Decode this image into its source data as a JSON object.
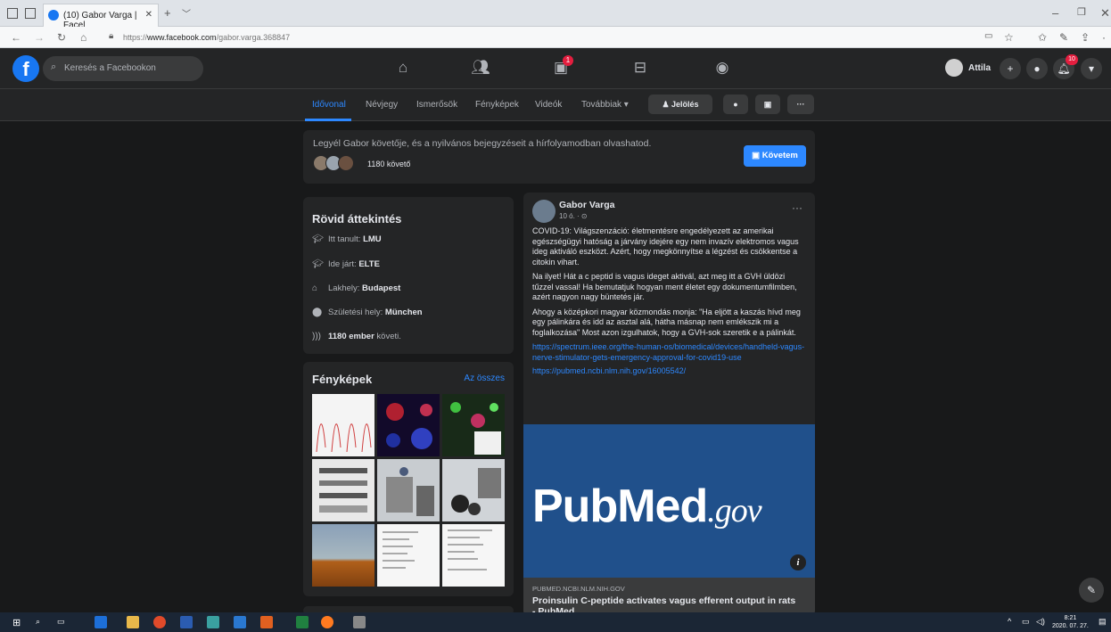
{
  "browser": {
    "tab_title": "(10) Gabor Varga | Facel",
    "url_prefix": "https://",
    "url_host": "www.facebook.com",
    "url_path": "/gabor.varga.368847"
  },
  "fbnav": {
    "search_placeholder": "Keresés a Facebookon",
    "watch_badge": "1",
    "user_name": "Attila",
    "notif_badge": "10"
  },
  "profile_tabs": {
    "items": [
      "Idővonal",
      "Névjegy",
      "Ismerősök",
      "Fényképek",
      "Videók",
      "Továbbiak ▾"
    ],
    "tag_button": "Jelölés",
    "more_button": "···"
  },
  "follow_box": {
    "text": "Legyél Gabor követője, és a nyilvános bejegyzéseit a hírfolyamodban olvashatod.",
    "followers": "1180 követő",
    "follow_button": "Követem"
  },
  "intro": {
    "title": "Rövid áttekintés",
    "rows": [
      {
        "icon": "graduation-cap-icon",
        "label": "Itt tanult: ",
        "value": "LMU"
      },
      {
        "icon": "graduation-cap-icon",
        "label": "Ide járt: ",
        "value": "ELTE"
      },
      {
        "icon": "home-icon",
        "label": "Lakhely: ",
        "value": "Budapest"
      },
      {
        "icon": "location-pin-icon",
        "label": "Születési hely: ",
        "value": "München"
      },
      {
        "icon": "rss-icon",
        "label": "",
        "value": "1180 ember",
        "suffix": " követi."
      }
    ]
  },
  "photos": {
    "title": "Fényképek",
    "see_all": "Az összes"
  },
  "post": {
    "author": "Gabor Varga",
    "meta": "10 ó. · ⊙",
    "more": "···",
    "paragraphs": [
      "COVID-19: Világszenzáció: életmentésre engedélyezett az amerikai egészségügyi hatóság a járvány idejére egy nem invazív elektromos vagus ideg aktiváló eszközt. Azért, hogy megkönnyítse a légzést és csökkentse a citokin vihart.",
      "Na ilyet! Hát a c peptid is vagus ideget aktivál, azt meg itt a GVH üldözi tűzzel vassal! Ha bemutatjuk hogyan ment életet egy dokumentumfilmben, azért nagyon nagy büntetés jár.",
      "Ahogy a középkori magyar közmondás monja: \"Ha eljött a kaszás hívd meg egy pálinkára és idd az asztal alá, hátha másnap nem emlékszik mi a foglalkozása\" Most azon izgulhatok, hogy a GVH-sok szeretik e a pálinkát."
    ],
    "links": [
      "https://spectrum.ieee.org/the-human-os/biomedical/devices/handheld-vagus-nerve-stimulator-gets-emergency-approval-for-covid19-use",
      "https://pubmed.ncbi.nlm.nih.gov/16005542/"
    ],
    "preview_logo_a": "Pub",
    "preview_logo_b": "Med",
    "preview_logo_c": ".gov",
    "link_site": "PUBMED.NCBI.NLM.NIH.GOV",
    "link_title": "Proinsulin C-peptide activates vagus efferent output in rats - PubMed"
  },
  "taskbar": {
    "time": "8:21",
    "date": "2020. 07. 27."
  },
  "colors": {
    "fb_blue": "#1877f2",
    "link_blue": "#2d88ff",
    "card_bg": "#242526",
    "page_bg": "#18191a",
    "pubmed_bg": "#20508b"
  }
}
